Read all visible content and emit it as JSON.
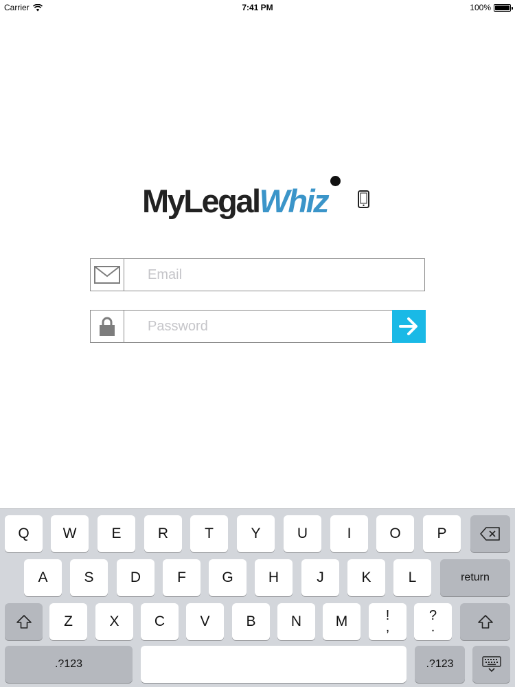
{
  "status_bar": {
    "carrier": "Carrier",
    "time": "7:41 PM",
    "battery": "100%"
  },
  "logo": {
    "part1": "MyLegal",
    "part2": "Whiz"
  },
  "login": {
    "email_placeholder": "Email",
    "password_placeholder": "Password"
  },
  "colors": {
    "brand_blue": "#3b95c9",
    "submit_blue": "#1ab9e6"
  },
  "keyboard": {
    "row1": [
      "Q",
      "W",
      "E",
      "R",
      "T",
      "Y",
      "U",
      "I",
      "O",
      "P"
    ],
    "row2": [
      "A",
      "S",
      "D",
      "F",
      "G",
      "H",
      "J",
      "K",
      "L"
    ],
    "row3": [
      "Z",
      "X",
      "C",
      "V",
      "B",
      "N",
      "M"
    ],
    "punct1": [
      "!",
      ","
    ],
    "punct2": [
      "?",
      "."
    ],
    "return_label": "return",
    "numbers_label": ".?123"
  }
}
